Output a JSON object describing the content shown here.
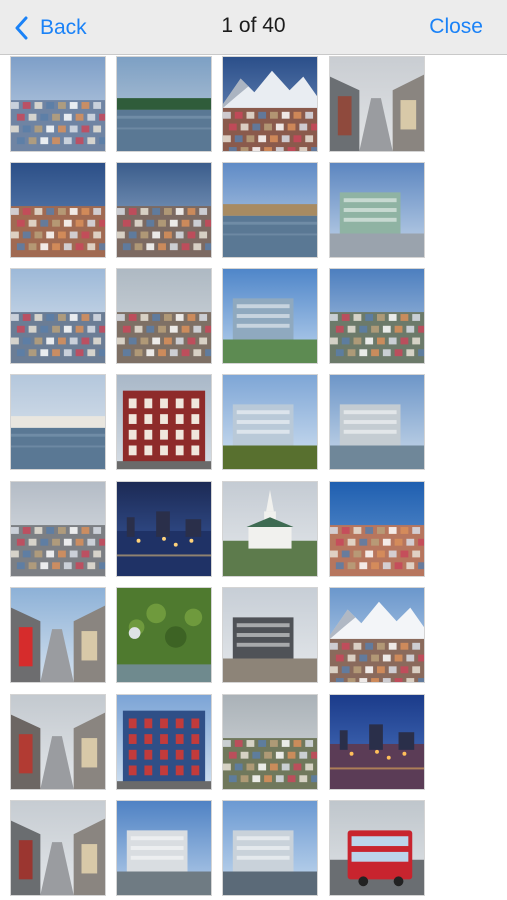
{
  "navbar": {
    "back_label": "Back",
    "title": "1 of 40",
    "close_label": "Close"
  },
  "colors": {
    "accent": "#1a82f7",
    "navbar_bg": "#ececec"
  },
  "thumbnails": [
    {
      "name": "thumb-1",
      "scene": "city",
      "sky": [
        "#7e9fc8",
        "#c9d6e6"
      ],
      "ground": "#6f84a3",
      "accent": "#d8dde6"
    },
    {
      "name": "thumb-2",
      "scene": "harbor",
      "sky": [
        "#7da0c4",
        "#c2cedb"
      ],
      "ground": "#4f6f63",
      "accent": "#2f5c3a"
    },
    {
      "name": "thumb-3",
      "scene": "mountain",
      "sky": [
        "#2b4f8a",
        "#7c98c3"
      ],
      "ground": "#8a5a4c",
      "accent": "#e9edf2"
    },
    {
      "name": "thumb-4",
      "scene": "street",
      "sky": [
        "#c9cdd2",
        "#e2e4e6"
      ],
      "ground": "#6b6f73",
      "accent": "#8f4a3d"
    },
    {
      "name": "thumb-5",
      "scene": "city",
      "sky": [
        "#2c4f87",
        "#6b8ebd"
      ],
      "ground": "#a06a52",
      "accent": "#e7d9cc"
    },
    {
      "name": "thumb-6",
      "scene": "city",
      "sky": [
        "#3b5d8c",
        "#9db5d1"
      ],
      "ground": "#7c6a62",
      "accent": "#dcd3cb"
    },
    {
      "name": "thumb-7",
      "scene": "harbor",
      "sky": [
        "#5f8bc6",
        "#c8d8ea"
      ],
      "ground": "#5a6670",
      "accent": "#a88b62"
    },
    {
      "name": "thumb-8",
      "scene": "modern",
      "sky": [
        "#5c86c0",
        "#c4d6ea"
      ],
      "ground": "#9aa3ad",
      "accent": "#8fb3a3"
    },
    {
      "name": "thumb-9",
      "scene": "city",
      "sky": [
        "#9db9d8",
        "#dfe6ee"
      ],
      "ground": "#6b7d95",
      "accent": "#c8485a"
    },
    {
      "name": "thumb-10",
      "scene": "city",
      "sky": [
        "#aeb9c3",
        "#d5dade"
      ],
      "ground": "#7e7065",
      "accent": "#b24c3a"
    },
    {
      "name": "thumb-11",
      "scene": "modern",
      "sky": [
        "#4f86c9",
        "#bcd4ee"
      ],
      "ground": "#5d8b52",
      "accent": "#8fa9bf"
    },
    {
      "name": "thumb-12",
      "scene": "city",
      "sky": [
        "#4d7fbf",
        "#b9cde4"
      ],
      "ground": "#6c7a6a",
      "accent": "#c9d1d8"
    },
    {
      "name": "thumb-13",
      "scene": "harbor",
      "sky": [
        "#b4c7dc",
        "#e3e9ef"
      ],
      "ground": "#48606d",
      "accent": "#e9e6df"
    },
    {
      "name": "thumb-14",
      "scene": "building",
      "sky": [
        "#a9b8c8",
        "#d6dde4"
      ],
      "ground": "#8e2b2a",
      "accent": "#f0e6dc"
    },
    {
      "name": "thumb-15",
      "scene": "modern",
      "sky": [
        "#7ea6d6",
        "#d2e1f1"
      ],
      "ground": "#58702f",
      "accent": "#b9c9d8"
    },
    {
      "name": "thumb-16",
      "scene": "modern",
      "sky": [
        "#6d96c8",
        "#cbdbeb"
      ],
      "ground": "#6f8799",
      "accent": "#c4ccd2"
    },
    {
      "name": "thumb-17",
      "scene": "city",
      "sky": [
        "#b4bcc6",
        "#dfe3e7"
      ],
      "ground": "#7c7f84",
      "accent": "#9aa1a8"
    },
    {
      "name": "thumb-18",
      "scene": "night",
      "sky": [
        "#1c2a55",
        "#3c5ea5"
      ],
      "ground": "#1f3266",
      "accent": "#ffd27a"
    },
    {
      "name": "thumb-19",
      "scene": "church",
      "sky": [
        "#c4cbd3",
        "#e6e9ec"
      ],
      "ground": "#5d7b4c",
      "accent": "#f1f1ee"
    },
    {
      "name": "thumb-20",
      "scene": "city",
      "sky": [
        "#1f5fb0",
        "#6a9ad3"
      ],
      "ground": "#b7765e",
      "accent": "#eed7c7"
    },
    {
      "name": "thumb-21",
      "scene": "street",
      "sky": [
        "#8db1d7",
        "#d4e1ee"
      ],
      "ground": "#6d6d6f",
      "accent": "#d62c2c"
    },
    {
      "name": "thumb-22",
      "scene": "wall",
      "sky": [
        "#d9dfe3",
        "#eef1f3"
      ],
      "ground": "#4f7a2f",
      "accent": "#6f9a3d"
    },
    {
      "name": "thumb-23",
      "scene": "modern",
      "sky": [
        "#c7ced6",
        "#e5e8eb"
      ],
      "ground": "#8d8478",
      "accent": "#4f5257"
    },
    {
      "name": "thumb-24",
      "scene": "mountain",
      "sky": [
        "#6b97cc",
        "#c3d7ec"
      ],
      "ground": "#8a6a5c",
      "accent": "#f3f5f8"
    },
    {
      "name": "thumb-25",
      "scene": "street",
      "sky": [
        "#c3c9cf",
        "#e3e6e9"
      ],
      "ground": "#6c6663",
      "accent": "#b23b33"
    },
    {
      "name": "thumb-26",
      "scene": "building",
      "sky": [
        "#7ca4d6",
        "#d0e0f0"
      ],
      "ground": "#2f4f87",
      "accent": "#c23b3b"
    },
    {
      "name": "thumb-27",
      "scene": "city",
      "sky": [
        "#aab2b8",
        "#d7dadc"
      ],
      "ground": "#70785c",
      "accent": "#c7b89d"
    },
    {
      "name": "thumb-28",
      "scene": "night",
      "sky": [
        "#1b3b8a",
        "#4f79c4"
      ],
      "ground": "#5b3c56",
      "accent": "#ffbf5a"
    },
    {
      "name": "thumb-29",
      "scene": "street",
      "sky": [
        "#c6ccd2",
        "#e3e6e9"
      ],
      "ground": "#6a6d70",
      "accent": "#9b3630"
    },
    {
      "name": "thumb-30",
      "scene": "modern",
      "sky": [
        "#4f82c4",
        "#b7cfea"
      ],
      "ground": "#6f7b83",
      "accent": "#d9dde1"
    },
    {
      "name": "thumb-31",
      "scene": "modern",
      "sky": [
        "#6b99d2",
        "#c7dbef"
      ],
      "ground": "#5b6a78",
      "accent": "#c9d2da"
    },
    {
      "name": "thumb-32",
      "scene": "bus",
      "sky": [
        "#bfc6cc",
        "#e1e4e7"
      ],
      "ground": "#6a6e72",
      "accent": "#c8242e"
    }
  ]
}
